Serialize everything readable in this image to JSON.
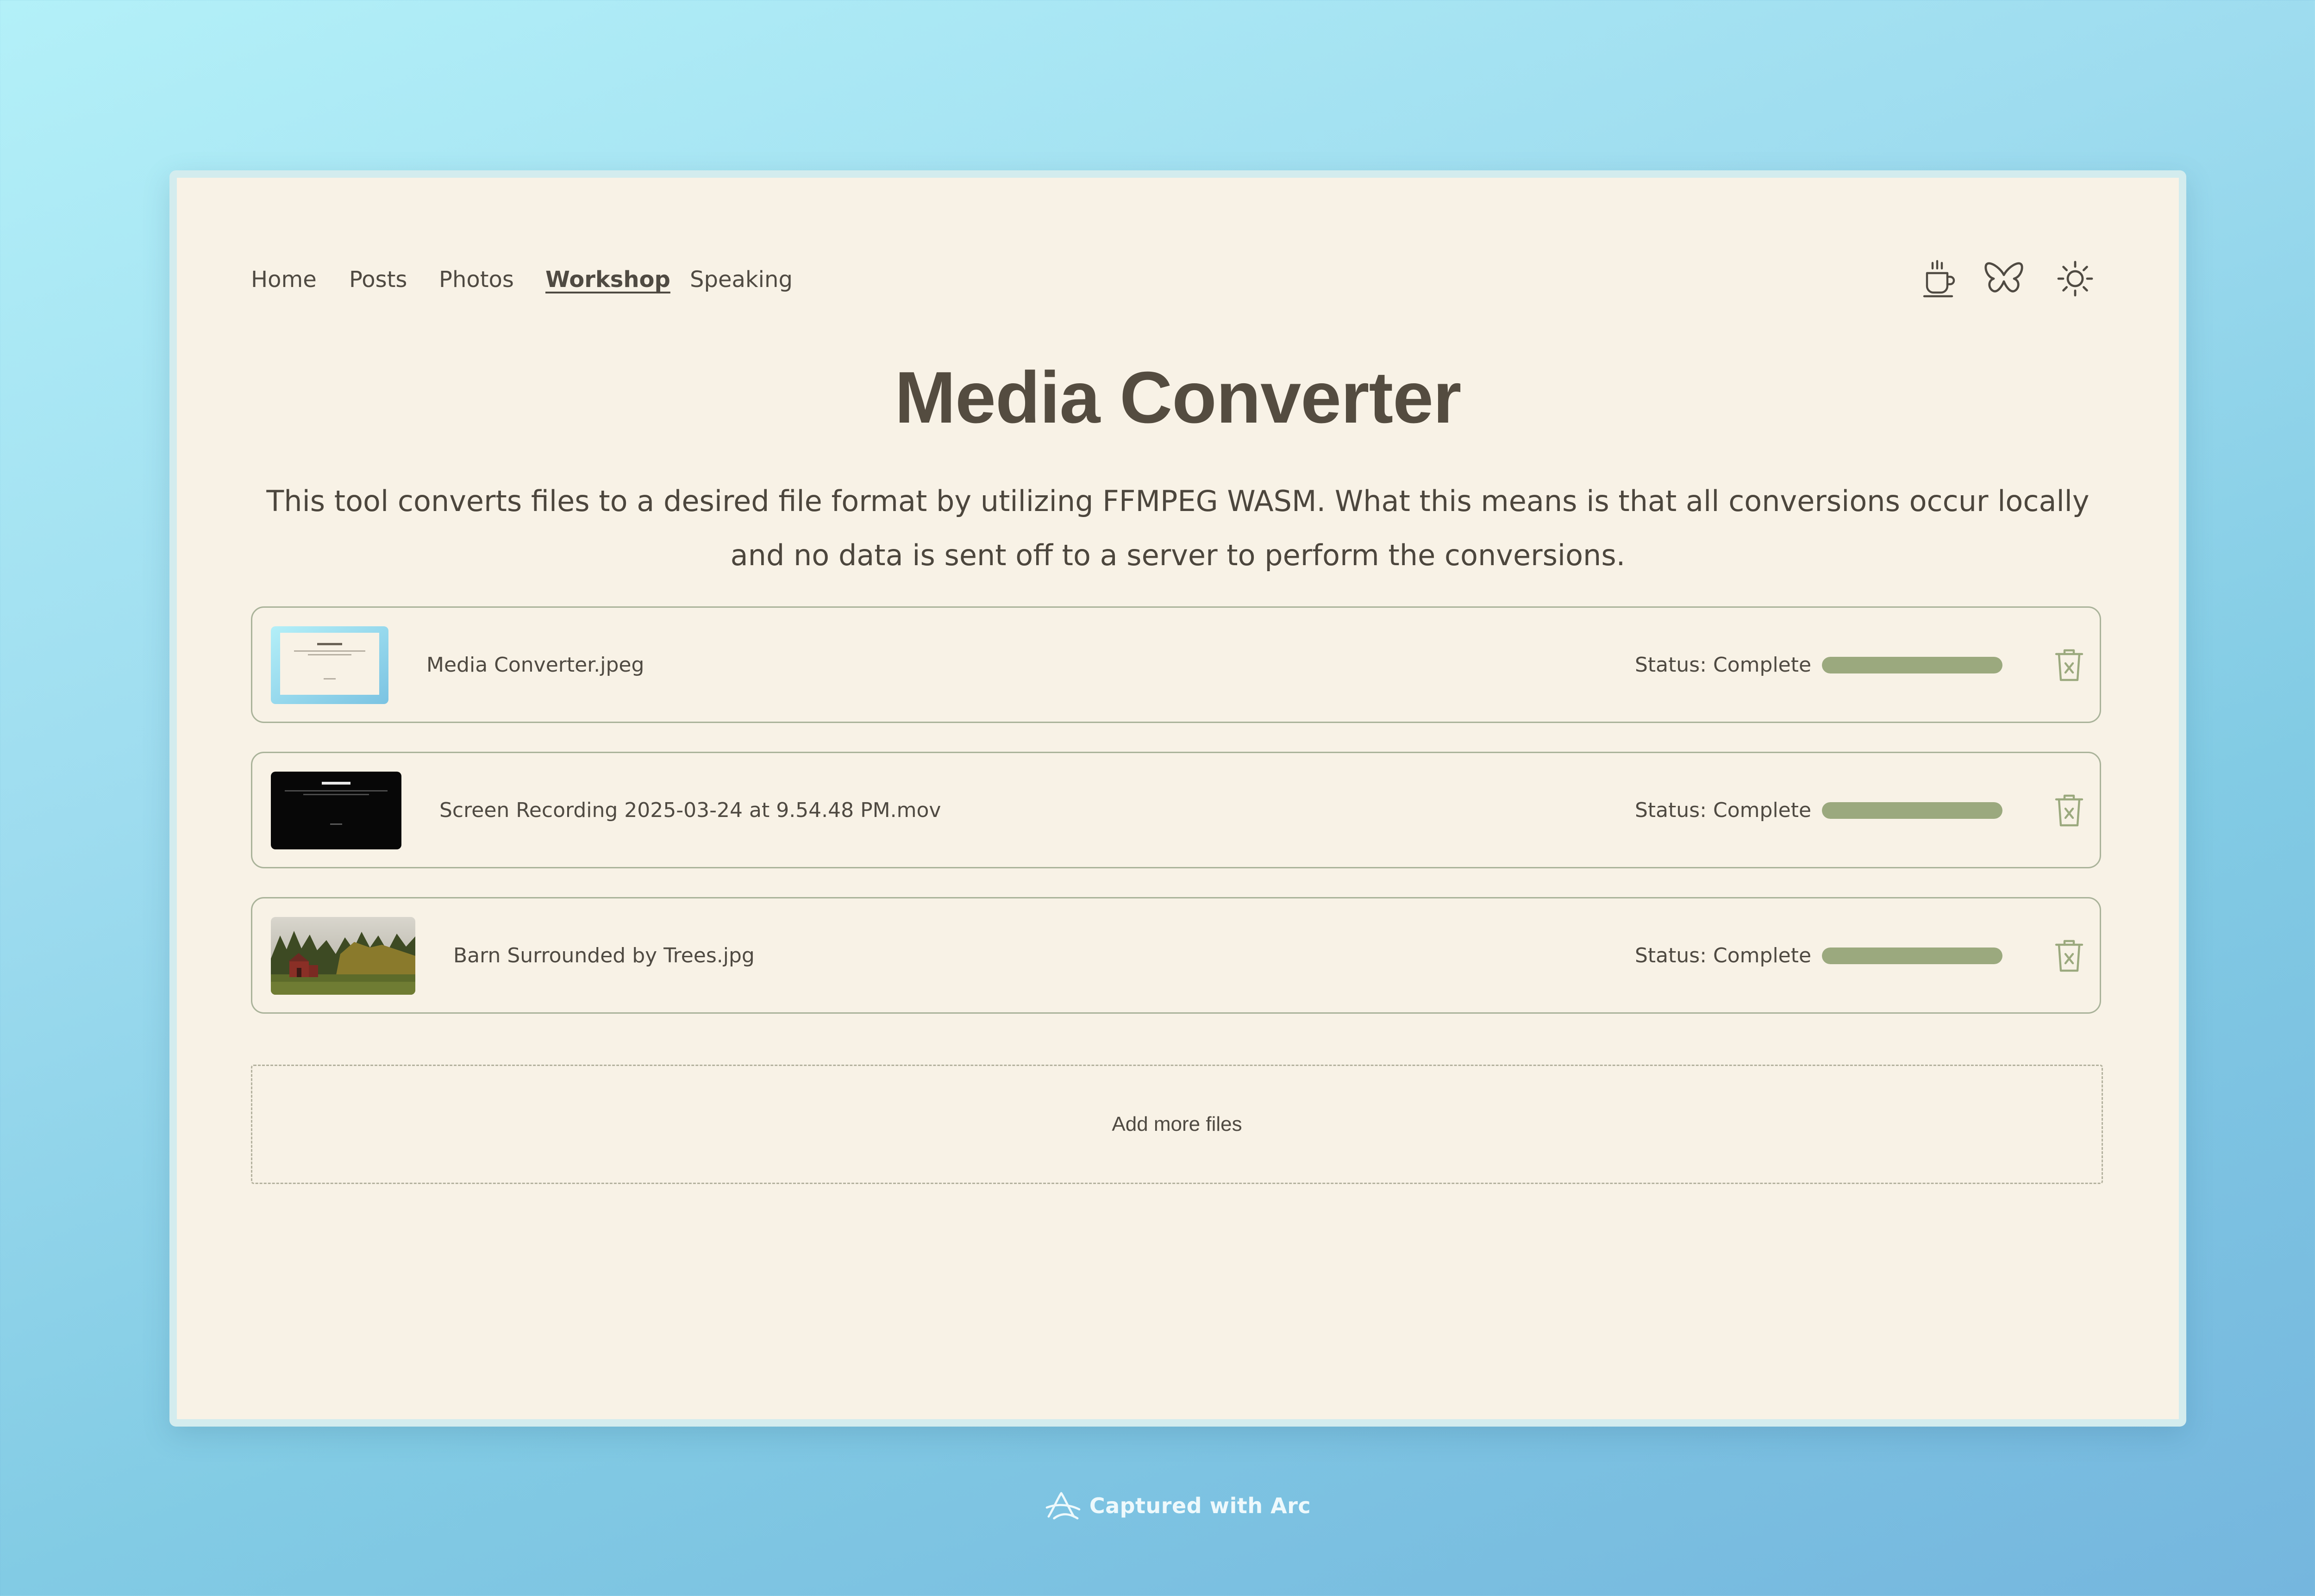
{
  "nav": {
    "items": [
      {
        "label": "Home",
        "active": false
      },
      {
        "label": "Posts",
        "active": false
      },
      {
        "label": "Photos",
        "active": false
      },
      {
        "label": "Workshop",
        "active": true
      },
      {
        "label": "Speaking",
        "active": false
      }
    ]
  },
  "header_icons": [
    "coffee-cup-icon",
    "butterfly-icon",
    "sun-icon"
  ],
  "page": {
    "title": "Media Converter",
    "description": "This tool converts files to a desired file format by utilizing FFMPEG WASM. What this means is that all conversions occur locally and no data is sent off to a server to perform the conversions."
  },
  "files": [
    {
      "name": "Media Converter.jpeg",
      "status": "Status: Complete",
      "progress": 1.0,
      "thumbnail_title": "Media Converter"
    },
    {
      "name": "Screen Recording 2025-03-24 at 9.54.48 PM.mov",
      "status": "Status: Complete",
      "progress": 1.0,
      "thumbnail_title": "Media Converter"
    },
    {
      "name": "Barn Surrounded by Trees.jpg",
      "status": "Status: Complete",
      "progress": 1.0
    }
  ],
  "add_files": {
    "label": "Add more files"
  },
  "footer": {
    "text": "Captured with Arc"
  },
  "colors": {
    "page_background": "#f8f2e6",
    "text": "#4f4a42",
    "title": "#544c40",
    "progress_fill": "#9ba97e",
    "row_border": "#aab39a",
    "delete_icon": "#9ba97e"
  }
}
